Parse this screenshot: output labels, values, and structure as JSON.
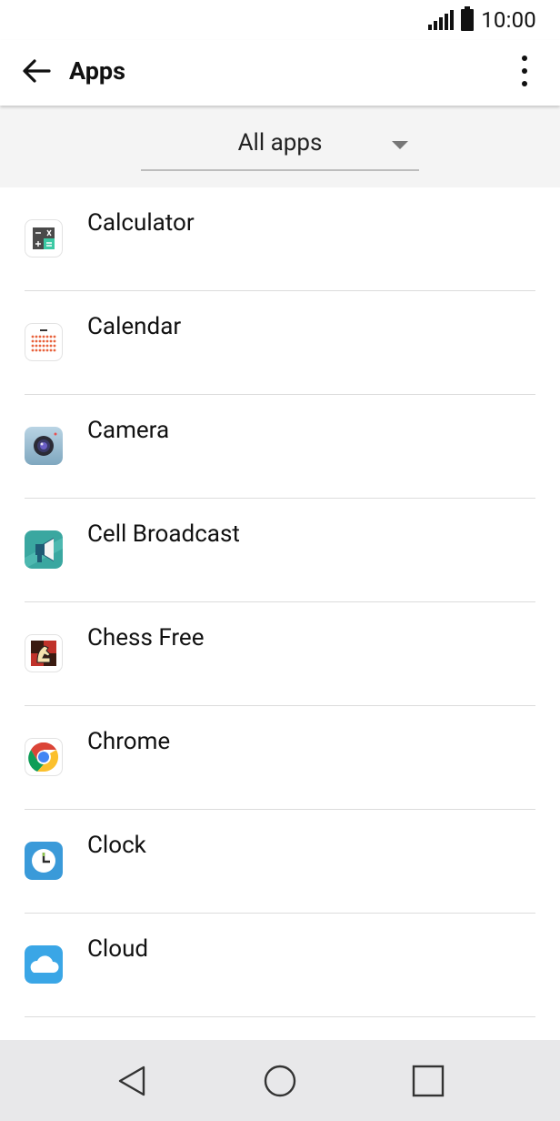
{
  "status_bar": {
    "time": "10:00"
  },
  "app_bar": {
    "title": "Apps"
  },
  "filter": {
    "selected": "All apps"
  },
  "apps": [
    {
      "name": "Calculator",
      "icon": "calculator-icon"
    },
    {
      "name": "Calendar",
      "icon": "calendar-icon"
    },
    {
      "name": "Camera",
      "icon": "camera-icon"
    },
    {
      "name": "Cell Broadcast",
      "icon": "cell-broadcast-icon"
    },
    {
      "name": "Chess Free",
      "icon": "chess-icon"
    },
    {
      "name": "Chrome",
      "icon": "chrome-icon"
    },
    {
      "name": "Clock",
      "icon": "clock-icon"
    },
    {
      "name": "Cloud",
      "icon": "cloud-icon"
    }
  ],
  "colors": {
    "nav_bar": "#e8e8ea",
    "filter_bg": "#f4f4f4",
    "divider": "#dcdcdc"
  }
}
